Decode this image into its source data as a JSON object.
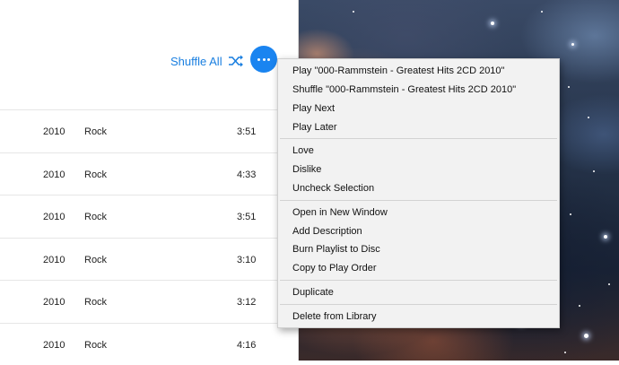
{
  "header": {
    "shuffle_label": "Shuffle All"
  },
  "rows": [
    {
      "year": "2010",
      "genre": "Rock",
      "duration": "3:51"
    },
    {
      "year": "2010",
      "genre": "Rock",
      "duration": "4:33"
    },
    {
      "year": "2010",
      "genre": "Rock",
      "duration": "3:51"
    },
    {
      "year": "2010",
      "genre": "Rock",
      "duration": "3:10"
    },
    {
      "year": "2010",
      "genre": "Rock",
      "duration": "3:12"
    },
    {
      "year": "2010",
      "genre": "Rock",
      "duration": "4:16"
    }
  ],
  "menu": {
    "play": "Play \"000-Rammstein - Greatest Hits 2CD 2010\"",
    "shuffle": "Shuffle \"000-Rammstein - Greatest Hits 2CD 2010\"",
    "play_next": "Play Next",
    "play_later": "Play Later",
    "love": "Love",
    "dislike": "Dislike",
    "uncheck_selection": "Uncheck Selection",
    "open_new_window": "Open in New Window",
    "add_description": "Add Description",
    "burn_playlist": "Burn Playlist to Disc",
    "copy_play_order": "Copy to Play Order",
    "duplicate": "Duplicate",
    "delete_library": "Delete from Library"
  },
  "colors": {
    "accent": "#1a84f0",
    "menu_bg": "#f2f2f2"
  }
}
